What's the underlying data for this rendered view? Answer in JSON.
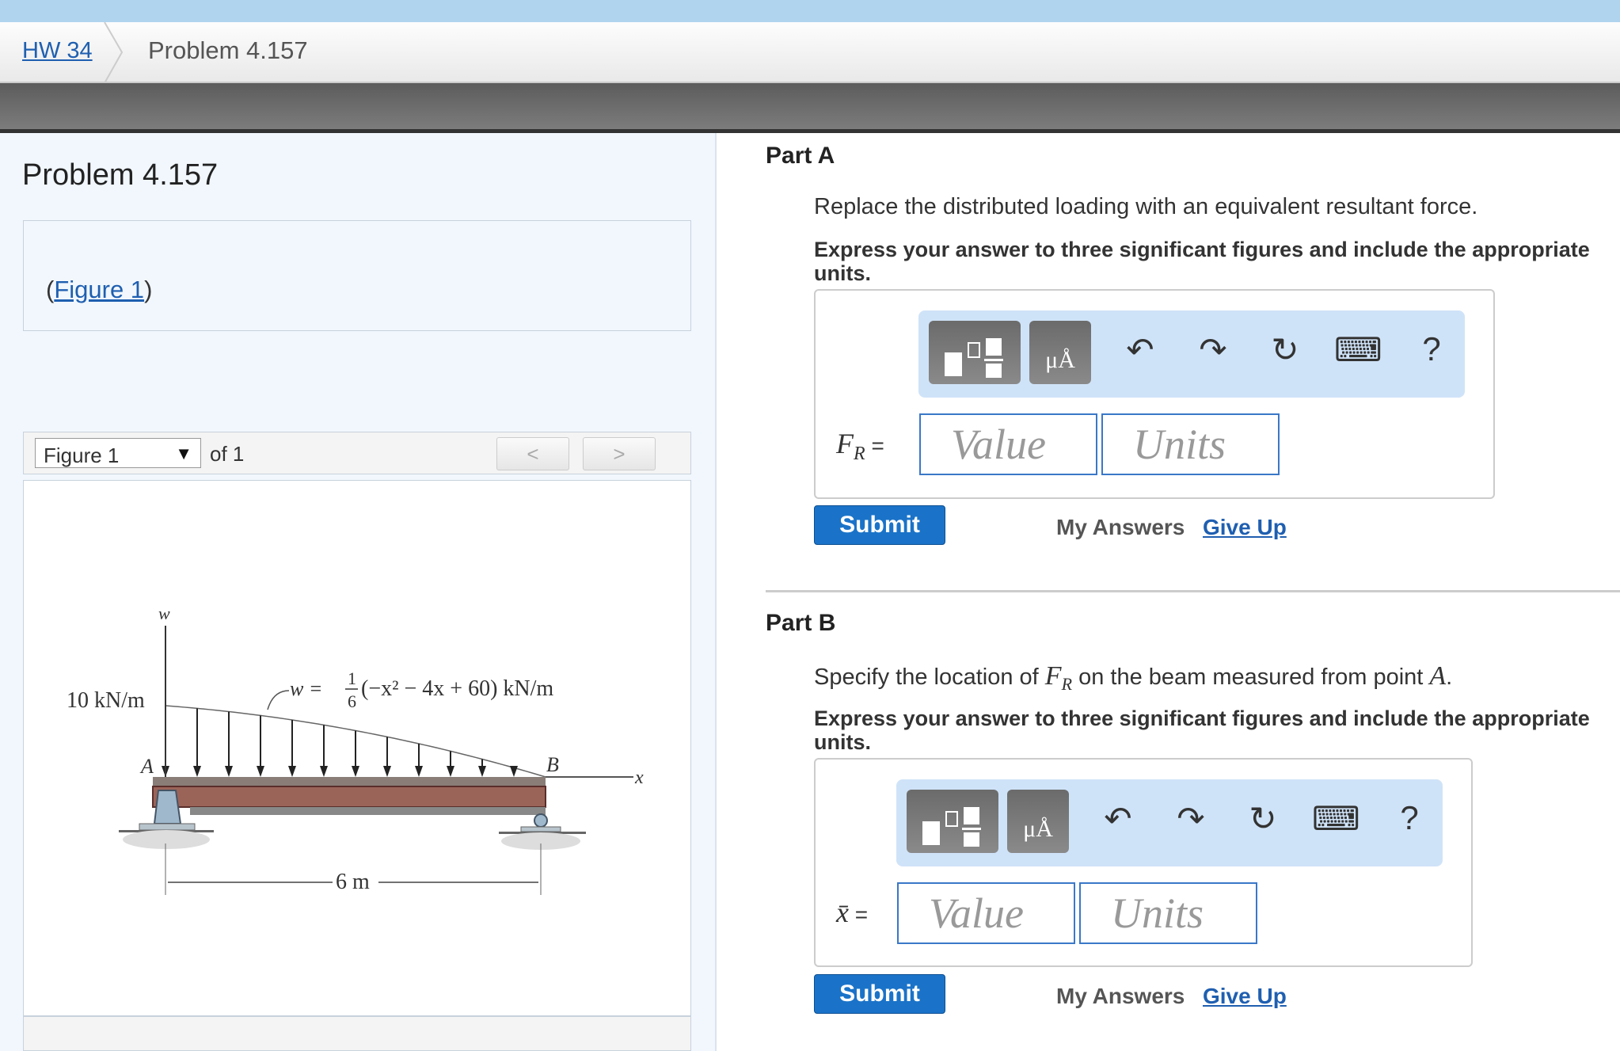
{
  "breadcrumb": {
    "parent": "HW 34",
    "current": "Problem 4.157"
  },
  "left": {
    "title": "Problem 4.157",
    "figure_link_prefix": "(",
    "figure_link": "Figure 1",
    "figure_link_suffix": ")",
    "figure_select": "Figure 1",
    "figure_of": "of 1",
    "prev": "<",
    "next": ">"
  },
  "figure": {
    "w_axis": "w",
    "x_axis": "x",
    "load_label": "10 kN/m",
    "eq_lhs": "w =",
    "eq_num": "1",
    "eq_den": "6",
    "eq_rhs": "(−x² − 4x + 60) kN/m",
    "point_a": "A",
    "point_b": "B",
    "span": "6 m"
  },
  "toolbar": {
    "undo": "↶",
    "redo": "↷",
    "reset": "↻",
    "keyboard": "⌨",
    "help": "?",
    "units_btn": "μÅ"
  },
  "partA": {
    "title": "Part A",
    "prompt": "Replace the distributed loading with an equivalent resultant force.",
    "instruction": "Express your answer to three significant figures and include the appropriate units.",
    "label": "F",
    "label_sub": "R",
    "label_eq": " =",
    "value_placeholder": "Value",
    "units_placeholder": "Units",
    "submit": "Submit",
    "my_answers": "My Answers",
    "give_up": "Give Up"
  },
  "partB": {
    "title": "Part B",
    "prompt_pre": "Specify the location of ",
    "prompt_var": "F",
    "prompt_sub": "R",
    "prompt_mid": " on the beam measured from point ",
    "prompt_pt": "A",
    "prompt_end": ".",
    "instruction": "Express your answer to three significant figures and include the appropriate units.",
    "label": "x̄",
    "label_eq": " =",
    "value_placeholder": "Value",
    "units_placeholder": "Units",
    "submit": "Submit",
    "my_answers": "My Answers",
    "give_up": "Give Up"
  }
}
